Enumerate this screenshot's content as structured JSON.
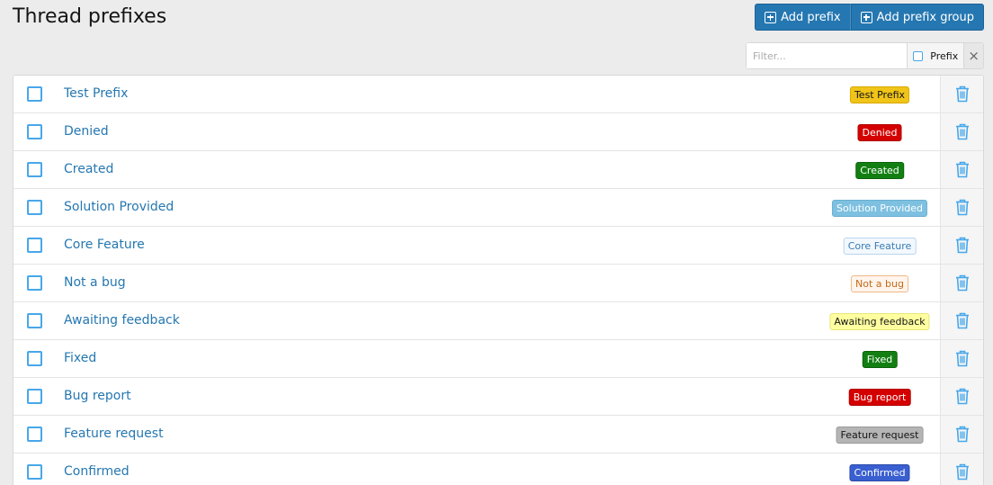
{
  "page": {
    "title": "Thread prefixes"
  },
  "toolbar": {
    "add_prefix_label": "Add prefix",
    "add_prefix_group_label": "Add prefix group"
  },
  "filter": {
    "placeholder": "Filter...",
    "option_label": "Prefix",
    "clear_icon": "×"
  },
  "colors": {
    "accent": "#2577b1",
    "link": "#2577b1",
    "checkbox": "#47a7eb"
  },
  "prefixes": [
    {
      "title": "Test Prefix",
      "badge": "Test Prefix",
      "style": "b-test"
    },
    {
      "title": "Denied",
      "badge": "Denied",
      "style": "b-denied"
    },
    {
      "title": "Created",
      "badge": "Created",
      "style": "b-created"
    },
    {
      "title": "Solution Provided",
      "badge": "Solution Provided",
      "style": "b-solution"
    },
    {
      "title": "Core Feature",
      "badge": "Core Feature",
      "style": "b-core"
    },
    {
      "title": "Not a bug",
      "badge": "Not a bug",
      "style": "b-notbug"
    },
    {
      "title": "Awaiting feedback",
      "badge": "Awaiting feedback",
      "style": "b-awaiting"
    },
    {
      "title": "Fixed",
      "badge": "Fixed",
      "style": "b-fixed"
    },
    {
      "title": "Bug report",
      "badge": "Bug report",
      "style": "b-bug"
    },
    {
      "title": "Feature request",
      "badge": "Feature request",
      "style": "b-feature"
    },
    {
      "title": "Confirmed",
      "badge": "Confirmed",
      "style": "b-confirmed"
    }
  ],
  "icons": {
    "row_delete": "trash-icon",
    "add": "plus-square-icon"
  }
}
